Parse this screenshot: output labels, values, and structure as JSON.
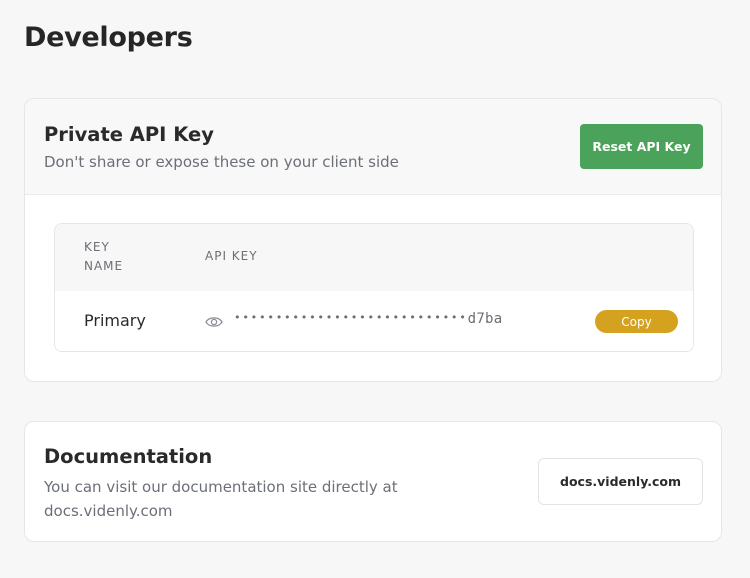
{
  "page": {
    "title": "Developers"
  },
  "api_card": {
    "title": "Private API Key",
    "subtitle": "Don't share or expose these on your client side",
    "reset_button": "Reset API Key",
    "reset_color": "#4ba25a",
    "table": {
      "headers": {
        "key_name_line1": "KEY",
        "key_name_line2": "NAME",
        "api_key": "API KEY"
      },
      "rows": [
        {
          "name": "Primary",
          "masked_dots": "••••••••••••••••••••••••••••",
          "key_suffix": "d7ba",
          "visibility_icon": "eye-icon",
          "copy_label": "Copy"
        }
      ]
    },
    "copy_color": "#d4a21f"
  },
  "docs_card": {
    "title": "Documentation",
    "text": "You can visit our documentation site directly at docs.videnly.com",
    "link_button": "docs.videnly.com"
  }
}
